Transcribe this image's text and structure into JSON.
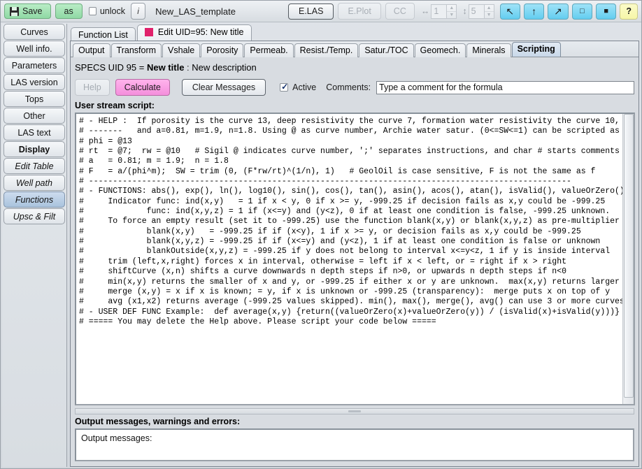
{
  "toolbar": {
    "save_label": "Save",
    "save_icon": "floppy-disk-icon",
    "as_label": "as",
    "unlock_label": "unlock",
    "unlock_checked": false,
    "info_label": "i",
    "template_name": "New_LAS_template",
    "elas_label": "E.LAS",
    "eplot_label": "E.Plot",
    "cc_label": "CC",
    "hspin_icon": "horizontal-arrows-icon",
    "hspin_value": "1",
    "vspin_icon": "vertical-arrows-icon",
    "vspin_value": "5",
    "nav_back_icon": "arrow-up-left-icon",
    "nav_up_icon": "arrow-up-icon",
    "nav_forward_icon": "arrow-up-right-icon",
    "restore_icon": "restore-window-icon",
    "maximize_icon": "maximize-window-icon",
    "help_label": "?"
  },
  "sidebar": {
    "items": [
      {
        "label": "Curves",
        "style": "normal",
        "selected": false
      },
      {
        "label": "Well info.",
        "style": "normal",
        "selected": false
      },
      {
        "label": "Parameters",
        "style": "normal",
        "selected": false
      },
      {
        "label": "LAS version",
        "style": "normal",
        "selected": false
      },
      {
        "label": "Tops",
        "style": "normal",
        "selected": false
      },
      {
        "label": "Other",
        "style": "normal",
        "selected": false
      },
      {
        "label": "LAS text",
        "style": "normal",
        "selected": false
      },
      {
        "label": "Display",
        "style": "bold",
        "selected": false
      },
      {
        "label": "Edit Table",
        "style": "italic",
        "selected": false
      },
      {
        "label": "Well path",
        "style": "italic",
        "selected": false
      },
      {
        "label": "Functions",
        "style": "italic",
        "selected": true
      },
      {
        "label": "Upsc & Filt",
        "style": "italic",
        "selected": false
      }
    ]
  },
  "doc_tabs": [
    {
      "label": "Function List",
      "active": false,
      "marker": false
    },
    {
      "label": "Edit UID=95: New title",
      "active": true,
      "marker": true
    }
  ],
  "sub_tabs": [
    {
      "label": "Output",
      "active": false
    },
    {
      "label": "Transform",
      "active": false
    },
    {
      "label": "Vshale",
      "active": false
    },
    {
      "label": "Porosity",
      "active": false
    },
    {
      "label": "Permeab.",
      "active": false
    },
    {
      "label": "Resist./Temp.",
      "active": false
    },
    {
      "label": "Satur./TOC",
      "active": false
    },
    {
      "label": "Geomech.",
      "active": false
    },
    {
      "label": "Minerals",
      "active": false
    },
    {
      "label": "Scripting",
      "active": true
    }
  ],
  "specs": {
    "prefix": "SPECS UID 95 = ",
    "title": "New title",
    "separator": " : ",
    "description": "New description"
  },
  "actions": {
    "help_label": "Help",
    "calculate_label": "Calculate",
    "clear_messages_label": "Clear Messages",
    "active_label": "Active",
    "active_checked": true,
    "comments_label": "Comments:",
    "comments_value": "Type a comment for the formula",
    "comments_placeholder": "Type a comment for the formula"
  },
  "editor": {
    "label": "User stream script:",
    "content": "# - HELP :  If porosity is the curve 13, deep resistivity the curve 7, formation water resistivity the curve 10,\n# -------   and a=0.81, m=1.9, n=1.8. Using @ as curve number, Archie water satur. (0<=SW<=1) can be scripted as\n# phi = @13\n# rt  = @7;  rw = @10   # Sigil @ indicates curve number, ';' separates instructions, and char # starts comments\n# a   = 0.81; m = 1.9;  n = 1.8\n# F   = a/(phi^m);  SW = trim (0, (F*rw/rt)^(1/n), 1)   # GeolOil is case sensitive, F is not the same as f\n# ----------------------------------------------------------------------------------------------------\n# - FUNCTIONS: abs(), exp(), ln(), log10(), sin(), cos(), tan(), asin(), acos(), atan(), isValid(), valueOrZero()\n#     Indicator func: ind(x,y)   = 1 if x < y, 0 if x >= y, -999.25 if decision fails as x,y could be -999.25\n#             func: ind(x,y,z) = 1 if (x<=y) and (y<z), 0 if at least one condition is false, -999.25 unknown.\n#     To force an empty result (set it to -999.25) use the function blank(x,y) or blank(x,y,z) as pre-multiplier\n#             blank(x,y)   = -999.25 if if (x<y), 1 if x >= y, or decision fails as x,y could be -999.25\n#             blank(x,y,z) = -999.25 if if (x<=y) and (y<z), 1 if at least one condition is false or unknown\n#             blankOutside(x,y,z) = -999.25 if y does not belong to interval x<=y<z, 1 if y is inside interval\n#     trim (left,x,right) forces x in interval, otherwise = left if x < left, or = right if x > right\n#     shiftCurve (x,n) shifts a curve downwards n depth steps if n>0, or upwards n depth steps if n<0\n#     min(x,y) returns the smaller of x and y, or -999.25 if either x or y are unknown.  max(x,y) returns larger\n#     merge (x,y) = x if x is known; = y, if x is unknown or -999.25 (transparency):  merge puts x on top of y\n#     avg (x1,x2) returns average (-999.25 values skipped). min(), max(), merge(), avg() can use 3 or more curves\n# - USER DEF FUNC Example:  def average(x,y) {return((valueOrZero(x)+valueOrZero(y)) / (isValid(x)+isValid(y)))}\n# ===== You may delete the Help above. Please script your code below ====="
  },
  "output": {
    "label": "Output messages, warnings and errors:",
    "content": "Output messages:"
  },
  "colors": {
    "accent_pink": "#e0216b",
    "calculate_pink": "#f48fdc",
    "save_green": "#8fd9a4",
    "nav_cyan": "#63cdf0",
    "help_yellow": "#f6f6a8",
    "tab_active_blue": "#c8d8e9"
  }
}
